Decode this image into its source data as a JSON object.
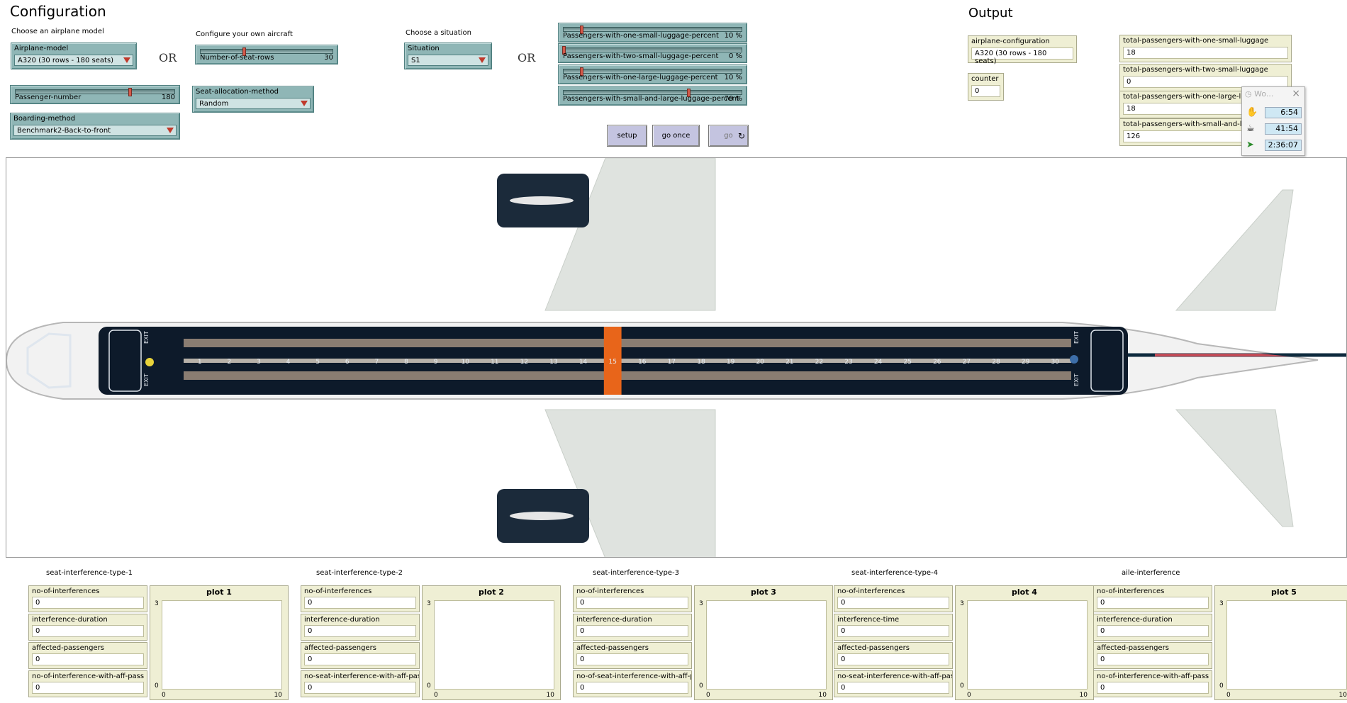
{
  "config": {
    "title": "Configuration",
    "choose_airplane_label": "Choose an airplane model",
    "configure_own_label": "Configure your own aircraft",
    "choose_situation_label": "Choose a situation",
    "or1": "OR",
    "or2": "OR",
    "airplane_model": {
      "label": "Airplane-model",
      "value": "A320 (30 rows - 180 seats)"
    },
    "number_of_seat_rows": {
      "label": "Number-of-seat-rows",
      "value": "30",
      "fraction": 0.33
    },
    "situation": {
      "label": "Situation",
      "value": "S1"
    },
    "passenger_number": {
      "label": "Passenger-number",
      "value": "180",
      "fraction": 0.72
    },
    "seat_allocation": {
      "label": "Seat-allocation-method",
      "value": "Random"
    },
    "boarding_method": {
      "label": "Boarding-method",
      "value": "Benchmark2-Back-to-front"
    },
    "luggage_sliders": [
      {
        "label": "Passengers-with-one-small-luggage-percent",
        "value": "10 %",
        "fraction": 0.1
      },
      {
        "label": "Passengers-with-two-small-luggage-percent",
        "value": "0 %",
        "fraction": 0.0
      },
      {
        "label": "Passengers-with-one-large-luggage-percent",
        "value": "10 %",
        "fraction": 0.1
      },
      {
        "label": "Passengers-with-small-and-large-luggage-percent",
        "value": "70 %",
        "fraction": 0.7
      }
    ],
    "buttons": {
      "setup": "setup",
      "go_once": "go once",
      "go": "go"
    }
  },
  "output": {
    "title": "Output",
    "airplane_configuration": {
      "label": "airplane-configuration",
      "value": "A320 (30 rows - 180 seats)"
    },
    "counter": {
      "label": "counter",
      "value": "0"
    },
    "totals": [
      {
        "label": "total-passengers-with-one-small-luggage",
        "value": "18"
      },
      {
        "label": "total-passengers-with-two-small-luggage",
        "value": "0"
      },
      {
        "label": "total-passengers-with-one-large-luggage",
        "value": "18"
      },
      {
        "label": "total-passengers-with-small-and-large-luggage",
        "value": "126"
      }
    ]
  },
  "timer_popup": {
    "title": "Wo...",
    "rows": [
      {
        "icon": "hand-icon",
        "value": "6:54"
      },
      {
        "icon": "coffee-icon",
        "value": "41:54"
      },
      {
        "icon": "exit-icon",
        "value": "2:36:07"
      }
    ]
  },
  "airplane": {
    "row_numbers": [
      "1",
      "2",
      "3",
      "4",
      "5",
      "6",
      "7",
      "8",
      "9",
      "10",
      "11",
      "12",
      "13",
      "14",
      "15",
      "16",
      "17",
      "18",
      "19",
      "20",
      "21",
      "22",
      "23",
      "24",
      "25",
      "26",
      "27",
      "28",
      "29",
      "30"
    ],
    "highlight_row": 15,
    "exit_label": "EXIT",
    "colors": {
      "fuselage": "#f2f2f2",
      "cabin": "#0d1a2a",
      "seat": "#0d1a2a",
      "aisle_stripe": "#8a7d72",
      "highlight": "#e8651a",
      "wing": "#dfe3df"
    }
  },
  "interference_groups": [
    {
      "title": "seat-interference-type-1",
      "monitors": [
        {
          "label": "no-of-interferences",
          "value": "0"
        },
        {
          "label": "interference-duration",
          "value": "0"
        },
        {
          "label": "affected-passengers",
          "value": "0"
        },
        {
          "label": "no-of-interference-with-aff-pass",
          "value": "0"
        }
      ],
      "plot": {
        "title": "plot 1",
        "ymax": "3",
        "ymin": "0",
        "xmin": "0",
        "xmax": "10"
      }
    },
    {
      "title": "seat-interference-type-2",
      "monitors": [
        {
          "label": "no-of-interferences",
          "value": "0"
        },
        {
          "label": "interference-duration",
          "value": "0"
        },
        {
          "label": "affected-passengers",
          "value": "0"
        },
        {
          "label": "no-seat-interference-with-aff-pass",
          "value": "0"
        }
      ],
      "plot": {
        "title": "plot 2",
        "ymax": "3",
        "ymin": "0",
        "xmin": "0",
        "xmax": "10"
      }
    },
    {
      "title": "seat-interference-type-3",
      "monitors": [
        {
          "label": "no-of-interferences",
          "value": "0"
        },
        {
          "label": "interference-duration",
          "value": "0"
        },
        {
          "label": "affected-passengers",
          "value": "0"
        },
        {
          "label": "no-of-seat-interference-with-aff-pass",
          "value": "0"
        }
      ],
      "plot": {
        "title": "plot 3",
        "ymax": "3",
        "ymin": "0",
        "xmin": "0",
        "xmax": "10"
      }
    },
    {
      "title": "seat-interference-type-4",
      "monitors": [
        {
          "label": "no-of-interferences",
          "value": "0"
        },
        {
          "label": "interference-time",
          "value": "0"
        },
        {
          "label": "affected-passengers",
          "value": "0"
        },
        {
          "label": "no-seat-interference-with-aff-pass",
          "value": "0"
        }
      ],
      "plot": {
        "title": "plot 4",
        "ymax": "3",
        "ymin": "0",
        "xmin": "0",
        "xmax": "10"
      }
    },
    {
      "title": "aile-interference",
      "monitors": [
        {
          "label": "no-of-interferences",
          "value": "0"
        },
        {
          "label": "interference-duration",
          "value": "0"
        },
        {
          "label": "affected-passengers",
          "value": "0"
        },
        {
          "label": "no-of-interference-with-aff-pass",
          "value": "0"
        }
      ],
      "plot": {
        "title": "plot 5",
        "ymax": "3",
        "ymin": "0",
        "xmin": "0",
        "xmax": "10"
      }
    }
  ]
}
